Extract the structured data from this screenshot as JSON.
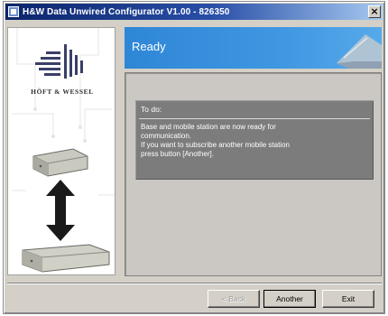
{
  "window": {
    "title": "H&W Data Unwired Configurator V1.00 - 826350",
    "close_label": "×"
  },
  "brand": {
    "name": "HÖFT & WESSEL"
  },
  "header": {
    "title": "Ready"
  },
  "todo": {
    "heading": "To do:",
    "lines": [
      "Base and mobile station are now ready for",
      "communication.",
      "If you want to subscribe another mobile station",
      "press button [Another]."
    ]
  },
  "buttons": {
    "back": "< Back",
    "another": "Another",
    "exit": "Exit"
  },
  "colors": {
    "banner_blue": "#2e86d6",
    "titlebar": "#0a246a",
    "todo_box": "#7c7c7c"
  }
}
